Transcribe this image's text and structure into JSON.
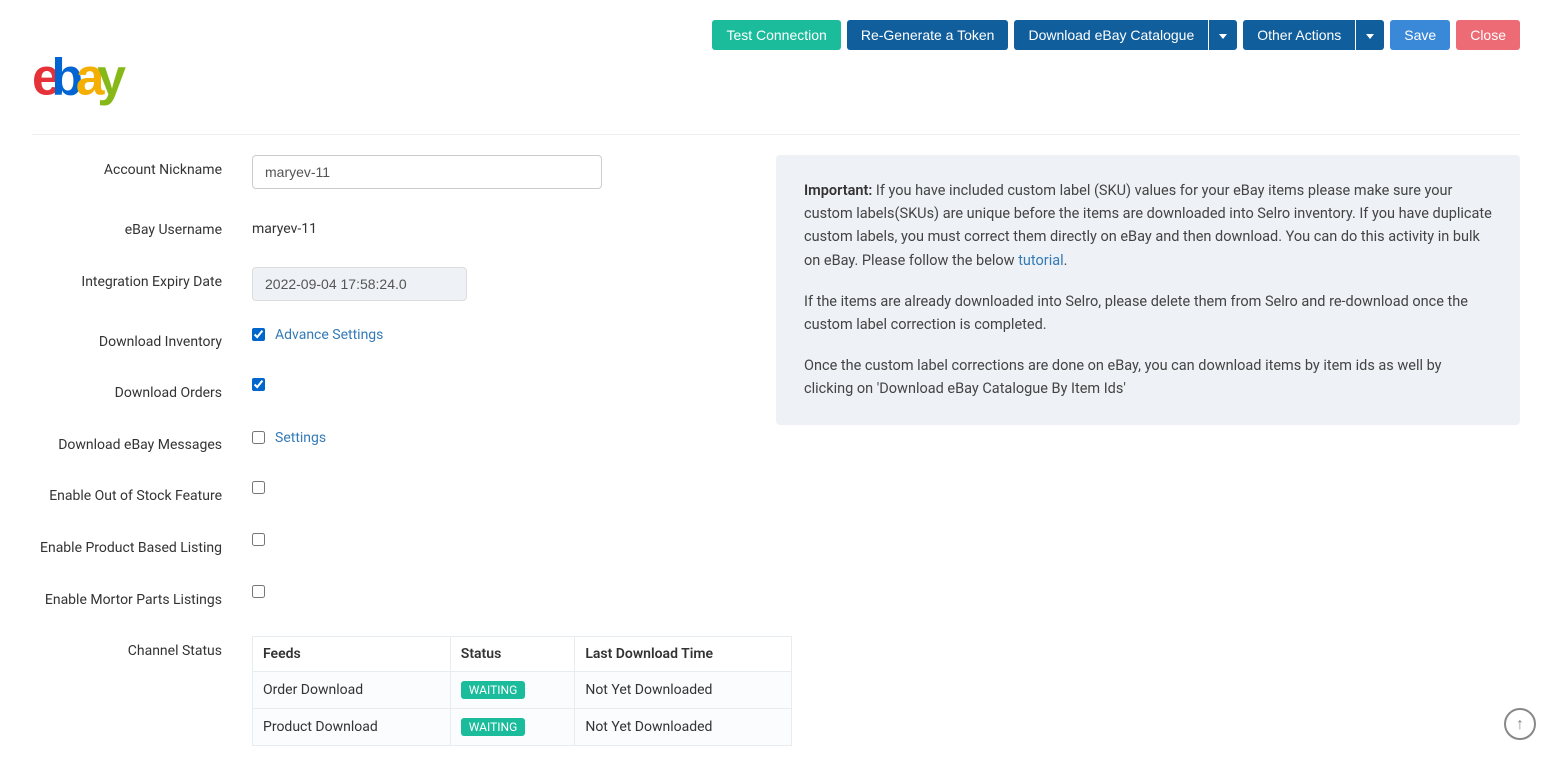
{
  "actions": {
    "test_connection": "Test Connection",
    "regenerate_token": "Re-Generate a Token",
    "download_catalogue": "Download eBay Catalogue",
    "other_actions": "Other Actions",
    "save": "Save",
    "close": "Close"
  },
  "form": {
    "account_nickname_label": "Account Nickname",
    "account_nickname_value": "maryev-11",
    "ebay_username_label": "eBay Username",
    "ebay_username_value": "maryev-11",
    "expiry_label": "Integration Expiry Date",
    "expiry_value": "2022-09-04 17:58:24.0",
    "download_inventory_label": "Download Inventory",
    "advance_settings_link": "Advance Settings",
    "download_orders_label": "Download Orders",
    "download_messages_label": "Download eBay Messages",
    "settings_link": "Settings",
    "out_of_stock_label": "Enable Out of Stock Feature",
    "product_based_label": "Enable Product Based Listing",
    "motor_parts_label": "Enable Mortor Parts Listings",
    "channel_status_label": "Channel Status"
  },
  "table": {
    "headers": {
      "feeds": "Feeds",
      "status": "Status",
      "last": "Last Download Time"
    },
    "rows": [
      {
        "feed": "Order Download",
        "status": "WAITING",
        "last": "Not Yet Downloaded"
      },
      {
        "feed": "Product Download",
        "status": "WAITING",
        "last": "Not Yet Downloaded"
      }
    ]
  },
  "info": {
    "important_label": "Important:",
    "para1": " If you have included custom label (SKU) values for your eBay items please make sure your custom labels(SKUs) are unique before the items are downloaded into Selro inventory. If you have duplicate custom labels, you must correct them directly on eBay and then download. You can do this activity in bulk on eBay. Please follow the below ",
    "tutorial_link": "tutorial",
    "period": ".",
    "para2": "If the items are already downloaded into Selro, please delete them from Selro and re-download once the custom label correction is completed.",
    "para3": "Once the custom label corrections are done on eBay, you can download items by item ids as well by clicking on 'Download eBay Catalogue By Item Ids'"
  }
}
